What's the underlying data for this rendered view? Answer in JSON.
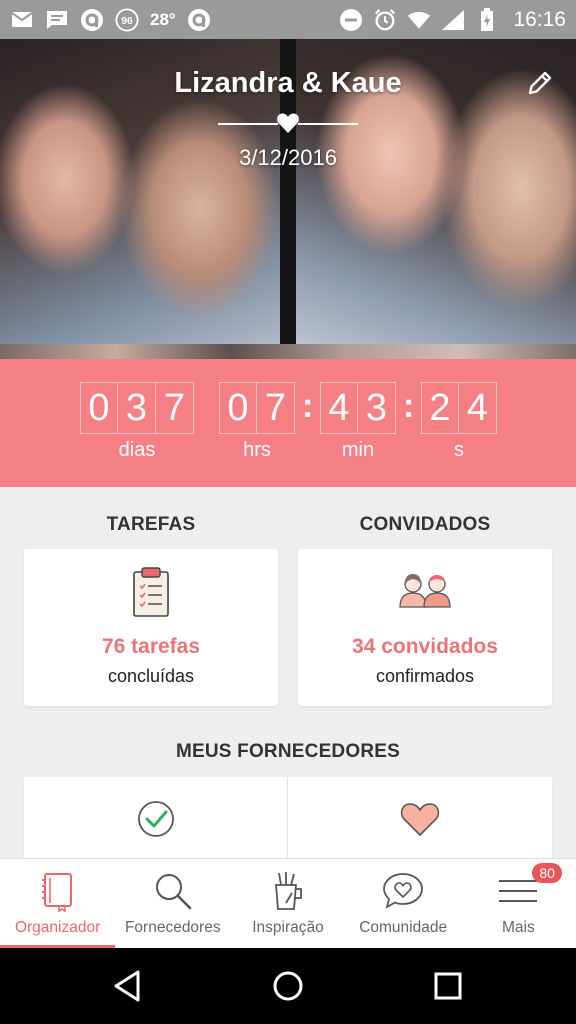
{
  "status_bar": {
    "notification_icons": [
      "mail-icon",
      "message-icon",
      "app-icon",
      "badge-96-icon",
      "weather-icon",
      "app-icon"
    ],
    "badge_number": "96",
    "temperature": "28°",
    "system_icons": [
      "dnd-icon",
      "alarm-icon",
      "wifi-icon",
      "signal-icon",
      "battery-icon"
    ],
    "time": "16:16"
  },
  "hero": {
    "couple_name": "Lizandra & Kaue",
    "date": "3/12/2016",
    "edit_icon": "pencil-icon"
  },
  "countdown": {
    "days": [
      "0",
      "3",
      "7"
    ],
    "hours": [
      "0",
      "7"
    ],
    "minutes": [
      "4",
      "3"
    ],
    "seconds": [
      "2",
      "4"
    ],
    "labels": {
      "days": "dias",
      "hours": "hrs",
      "minutes": "min",
      "seconds": "s"
    },
    "separator": ":"
  },
  "tasks": {
    "title": "TAREFAS",
    "value": "76 tarefas",
    "sub": "concluídas",
    "icon": "clipboard-icon"
  },
  "guests": {
    "title": "CONVIDADOS",
    "value": "34 convidados",
    "sub": "confirmados",
    "icon": "guests-icon"
  },
  "vendors": {
    "title": "MEUS FORNECEDORES",
    "left_icon": "check-circle-icon",
    "right_icon": "heart-icon"
  },
  "tabs": [
    {
      "label": "Organizador",
      "icon": "notebook-icon",
      "active": true
    },
    {
      "label": "Fornecedores",
      "icon": "search-icon",
      "active": false
    },
    {
      "label": "Inspiração",
      "icon": "inspiration-icon",
      "active": false
    },
    {
      "label": "Comunidade",
      "icon": "chat-heart-icon",
      "active": false
    },
    {
      "label": "Mais",
      "icon": "menu-icon",
      "active": false,
      "badge": "80"
    }
  ],
  "colors": {
    "accent": "#f47f85",
    "accent_text": "#e87578",
    "status_bar": "#9a9a9a"
  }
}
